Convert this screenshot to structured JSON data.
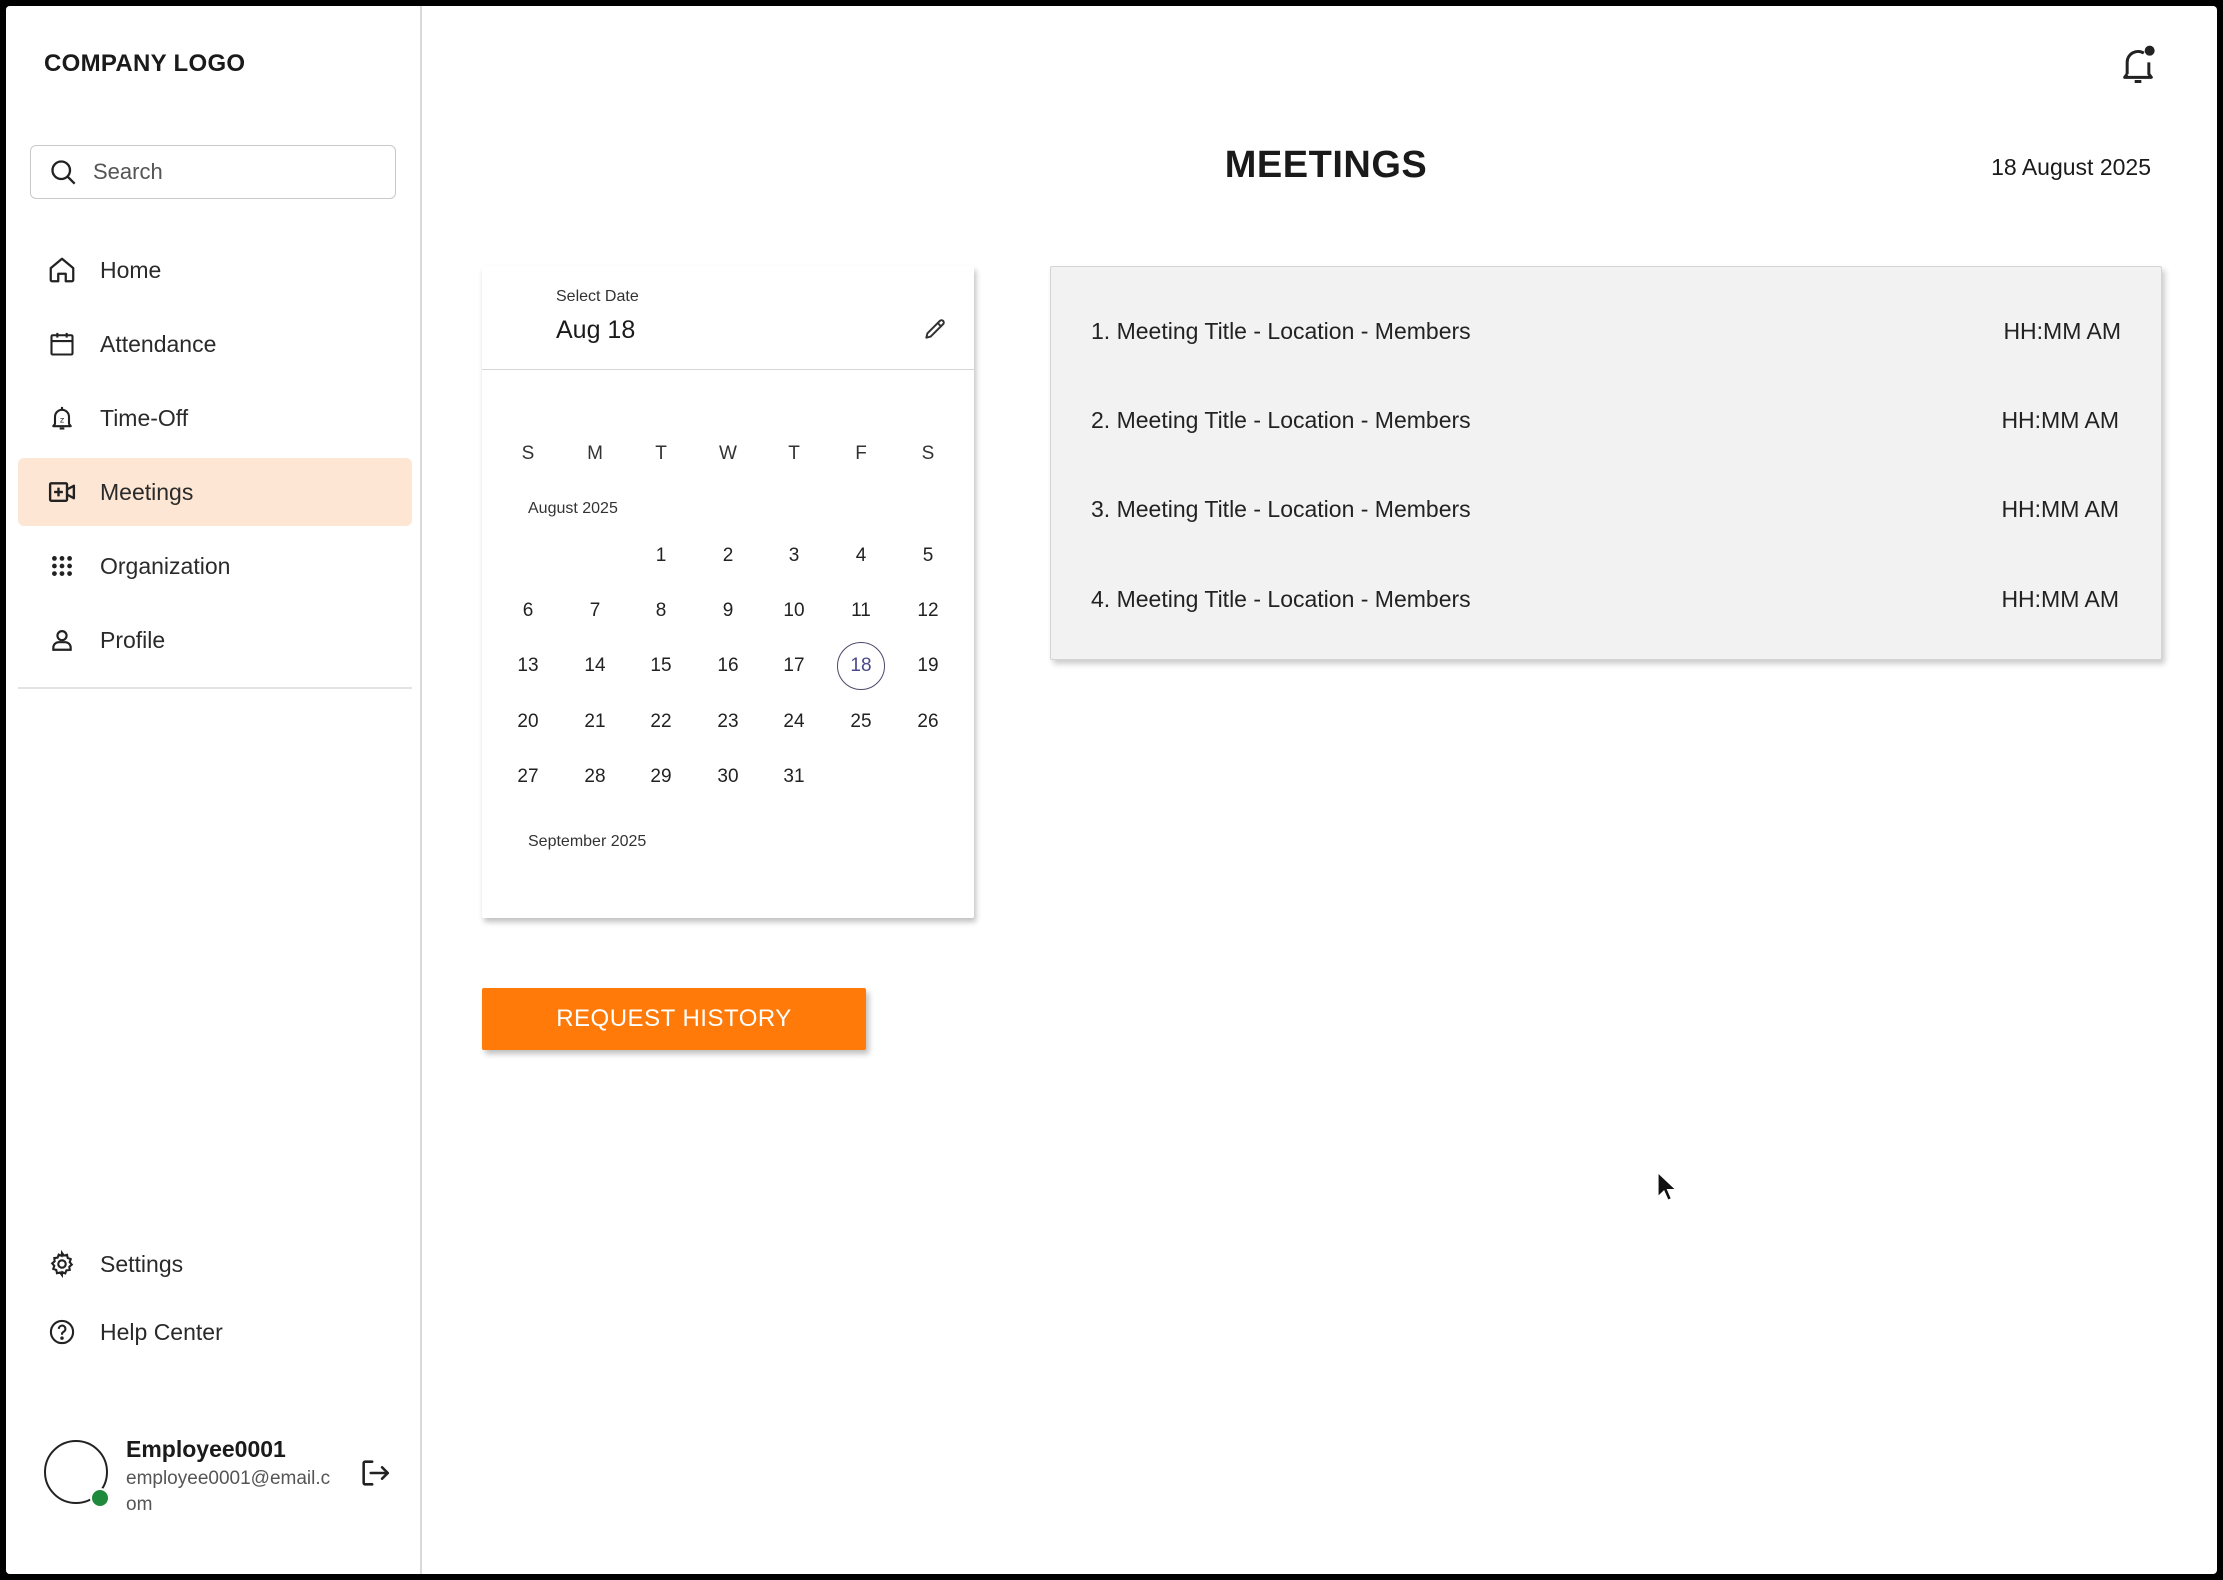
{
  "sidebar": {
    "logo": "COMPANY LOGO",
    "search_placeholder": "Search",
    "items": [
      {
        "label": "Home",
        "icon": "home-icon"
      },
      {
        "label": "Attendance",
        "icon": "calendar-icon"
      },
      {
        "label": "Time-Off",
        "icon": "time-off-bell-icon"
      },
      {
        "label": "Meetings",
        "icon": "video-add-icon",
        "active": true
      },
      {
        "label": "Organization",
        "icon": "grid-dots-icon"
      },
      {
        "label": "Profile",
        "icon": "person-icon"
      }
    ],
    "bottom_items": [
      {
        "label": "Settings",
        "icon": "gear-icon"
      },
      {
        "label": "Help Center",
        "icon": "help-circle-icon"
      }
    ],
    "user": {
      "name": "Employee0001",
      "email": "employee0001@email.com",
      "status_color": "#1f8a3b"
    }
  },
  "header": {
    "title": "MEETINGS",
    "date": "18 August 2025"
  },
  "calendar": {
    "label": "Select Date",
    "value": "Aug 18",
    "weekdays": [
      "S",
      "M",
      "T",
      "W",
      "T",
      "F",
      "S"
    ],
    "month_label": "August 2025",
    "next_month_label": "September 2025",
    "weeks": [
      [
        "",
        "",
        "1",
        "2",
        "3",
        "4",
        "5"
      ],
      [
        "6",
        "7",
        "8",
        "9",
        "10",
        "11",
        "12"
      ],
      [
        "13",
        "14",
        "15",
        "16",
        "17",
        "18",
        "19"
      ],
      [
        "20",
        "21",
        "22",
        "23",
        "24",
        "25",
        "26"
      ],
      [
        "27",
        "28",
        "29",
        "30",
        "31",
        "",
        ""
      ]
    ],
    "selected_day": "18"
  },
  "meetings": [
    {
      "title": "1. Meeting Title - Location - Members",
      "time": "HH:MM AM"
    },
    {
      "title": "2. Meeting Title - Location - Members",
      "time": "HH:MM AM"
    },
    {
      "title": "3. Meeting Title - Location - Members",
      "time": "HH:MM AM"
    },
    {
      "title": "4. Meeting Title - Location - Members",
      "time": "HH:MM AM"
    }
  ],
  "actions": {
    "request_history": "REQUEST HISTORY"
  },
  "colors": {
    "accent": "#ff7a08",
    "active_nav_bg": "#fde7d4",
    "meetings_panel_bg": "#f2f2f2"
  }
}
